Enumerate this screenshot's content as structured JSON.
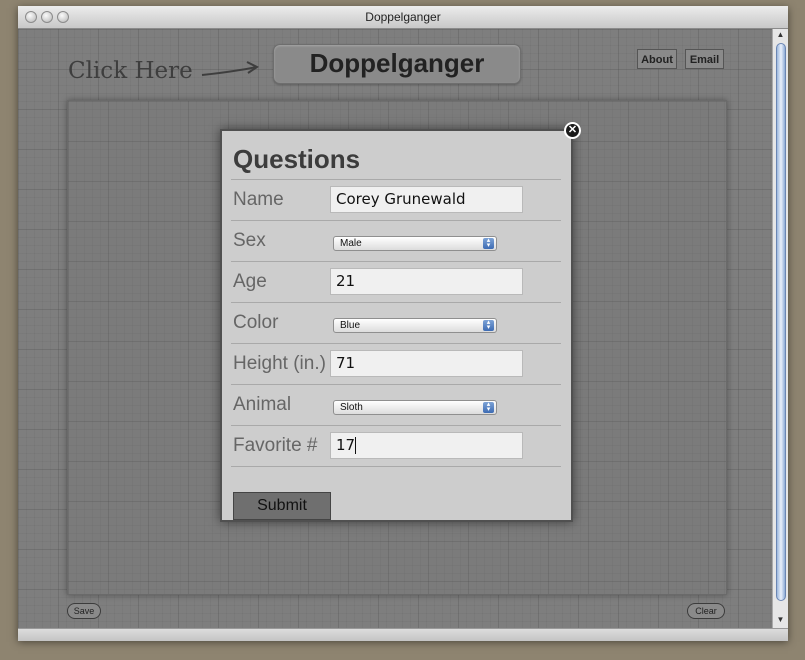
{
  "window": {
    "title": "Doppelganger"
  },
  "header": {
    "click_here": "Click Here",
    "logo": "Doppelganger",
    "nav": {
      "about": "About",
      "email": "Email"
    }
  },
  "dialog": {
    "title": "Questions",
    "fields": [
      {
        "label": "Name",
        "type": "text",
        "value": "Corey Grunewald"
      },
      {
        "label": "Sex",
        "type": "select",
        "value": "Male"
      },
      {
        "label": "Age",
        "type": "text",
        "value": "21"
      },
      {
        "label": "Color",
        "type": "select",
        "value": "Blue"
      },
      {
        "label": "Height (in.)",
        "type": "text",
        "value": "71"
      },
      {
        "label": "Animal",
        "type": "select",
        "value": "Sloth"
      },
      {
        "label": "Favorite #",
        "type": "text",
        "value": "17"
      }
    ],
    "submit_label": "Submit"
  },
  "footer": {
    "save_label": "Save",
    "clear_label": "Clear"
  },
  "icons": {
    "close": "close-icon",
    "arrow": "arrow-icon"
  }
}
